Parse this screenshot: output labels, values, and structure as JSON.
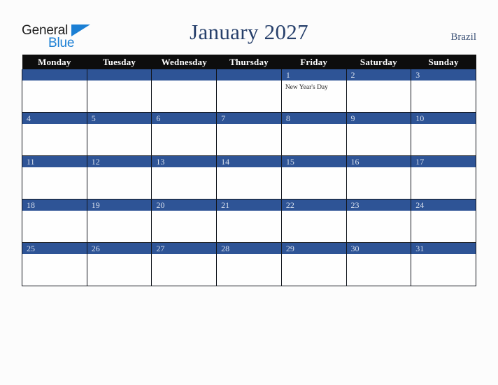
{
  "brand": {
    "name_part1": "General",
    "name_part2": "Blue",
    "color_dark": "#1c1c1c",
    "color_blue": "#1b7fd4"
  },
  "header": {
    "title": "January 2027",
    "country": "Brazil",
    "title_color": "#27406b"
  },
  "calendar": {
    "month": "January",
    "year": "2027",
    "week_start": "Monday",
    "weekdays": [
      "Monday",
      "Tuesday",
      "Wednesday",
      "Thursday",
      "Friday",
      "Saturday",
      "Sunday"
    ],
    "header_bg": "#0d0d0d",
    "daynum_bg": "#2e5496",
    "daynum_color": "#d7dfed",
    "cell_bg": "#fefefe",
    "weeks": [
      [
        {
          "day": "",
          "events": []
        },
        {
          "day": "",
          "events": []
        },
        {
          "day": "",
          "events": []
        },
        {
          "day": "",
          "events": []
        },
        {
          "day": "1",
          "events": [
            "New Year's Day"
          ]
        },
        {
          "day": "2",
          "events": []
        },
        {
          "day": "3",
          "events": []
        }
      ],
      [
        {
          "day": "4",
          "events": []
        },
        {
          "day": "5",
          "events": []
        },
        {
          "day": "6",
          "events": []
        },
        {
          "day": "7",
          "events": []
        },
        {
          "day": "8",
          "events": []
        },
        {
          "day": "9",
          "events": []
        },
        {
          "day": "10",
          "events": []
        }
      ],
      [
        {
          "day": "11",
          "events": []
        },
        {
          "day": "12",
          "events": []
        },
        {
          "day": "13",
          "events": []
        },
        {
          "day": "14",
          "events": []
        },
        {
          "day": "15",
          "events": []
        },
        {
          "day": "16",
          "events": []
        },
        {
          "day": "17",
          "events": []
        }
      ],
      [
        {
          "day": "18",
          "events": []
        },
        {
          "day": "19",
          "events": []
        },
        {
          "day": "20",
          "events": []
        },
        {
          "day": "21",
          "events": []
        },
        {
          "day": "22",
          "events": []
        },
        {
          "day": "23",
          "events": []
        },
        {
          "day": "24",
          "events": []
        }
      ],
      [
        {
          "day": "25",
          "events": []
        },
        {
          "day": "26",
          "events": []
        },
        {
          "day": "27",
          "events": []
        },
        {
          "day": "28",
          "events": []
        },
        {
          "day": "29",
          "events": []
        },
        {
          "day": "30",
          "events": []
        },
        {
          "day": "31",
          "events": []
        }
      ]
    ]
  }
}
